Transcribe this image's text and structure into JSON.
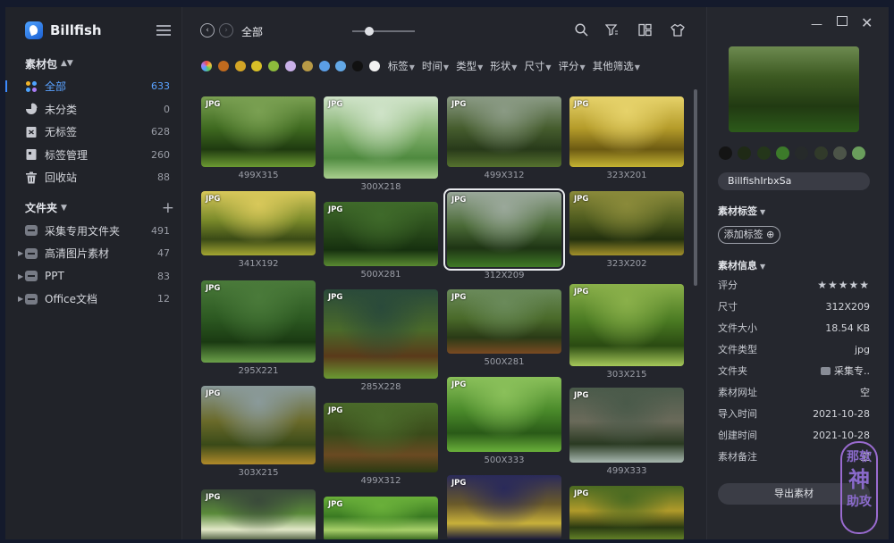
{
  "app": {
    "name": "Billfish"
  },
  "sidebar": {
    "library_title": "素材包",
    "items": [
      {
        "label": "全部",
        "count": "633",
        "icon": "all-grid-icon",
        "active": true
      },
      {
        "label": "未分类",
        "count": "0",
        "icon": "pie-icon"
      },
      {
        "label": "无标签",
        "count": "628",
        "icon": "no-tag-icon"
      },
      {
        "label": "标签管理",
        "count": "260",
        "icon": "tag-manage-icon"
      },
      {
        "label": "回收站",
        "count": "88",
        "icon": "trash-icon"
      }
    ],
    "folders_title": "文件夹",
    "folders": [
      {
        "label": "采集专用文件夹",
        "count": "491"
      },
      {
        "label": "高清图片素材",
        "count": "47"
      },
      {
        "label": "PPT",
        "count": "83"
      },
      {
        "label": "Office文档",
        "count": "12"
      }
    ]
  },
  "toolbar": {
    "breadcrumb": "全部"
  },
  "filters": {
    "colors": [
      "multi",
      "#c06a1e",
      "#d3a526",
      "#d8c028",
      "#8dba3c",
      "#c9b0e8",
      "#b89a46",
      "#5b9ee6",
      "#63a8e6",
      "#111111",
      "#f2f2f2"
    ],
    "labels": [
      "标签",
      "时间",
      "类型",
      "形状",
      "尺寸",
      "评分",
      "其他筛选"
    ]
  },
  "grid": {
    "badge": "JPG",
    "items": [
      {
        "size": "499X315",
        "colors": [
          "#7aa052",
          "#3f6a20",
          "#1f3a10",
          "#6c9a32"
        ]
      },
      {
        "size": "300X218",
        "colors": [
          "#cfe3c8",
          "#7fae6a",
          "#4f8a3f",
          "#a9d08e"
        ]
      },
      {
        "size": "499X312",
        "colors": [
          "#8a9a84",
          "#465d2e",
          "#283a1a",
          "#56722e"
        ]
      },
      {
        "size": "323X201",
        "colors": [
          "#e6d26a",
          "#b59c2a",
          "#6c5a12",
          "#c5b432"
        ]
      },
      {
        "size": "341X192",
        "colors": [
          "#d8c85a",
          "#7a8a2a",
          "#3a4a16",
          "#a4a632"
        ]
      },
      {
        "size": "500X281",
        "colors": [
          "#3f6a2a",
          "#28491a",
          "#16300f",
          "#5a8a32"
        ]
      },
      {
        "size": "312X209",
        "colors": [
          "#9aa89a",
          "#4a6a36",
          "#1e3414",
          "#3f7a26"
        ]
      },
      {
        "size": "323X202",
        "colors": [
          "#8a8a3a",
          "#4d5a1e",
          "#22300e",
          "#a3902a"
        ]
      },
      {
        "size": "295X221",
        "colors": [
          "#4a7a3a",
          "#2d5a22",
          "#1a3a12",
          "#6ca04a"
        ]
      },
      {
        "size": "285X228",
        "colors": [
          "#2a4a3a",
          "#4a6a2a",
          "#5a3a1a",
          "#6a9a32"
        ]
      },
      {
        "size": "500X281",
        "colors": [
          "#6a8a5a",
          "#4a6a2a",
          "#2a3a16",
          "#7a4a22"
        ]
      },
      {
        "size": "303X215",
        "colors": [
          "#8ab04a",
          "#4a7a22",
          "#2a4a12",
          "#a6c85a"
        ]
      },
      {
        "size": "303X215",
        "colors": [
          "#8a9a9a",
          "#6a6a2a",
          "#3a4a18",
          "#b08a2a"
        ]
      },
      {
        "size": "499X312",
        "colors": [
          "#4a6a2a",
          "#3a4a1a",
          "#6a4a22",
          "#2a3a12"
        ]
      },
      {
        "size": "500X333",
        "colors": [
          "#8ac05a",
          "#4a8a2a",
          "#2a5a18",
          "#6ab03a"
        ]
      },
      {
        "size": "499X333",
        "colors": [
          "#4a5a4a",
          "#6a6a5a",
          "#2a3a22",
          "#a8b8b0"
        ]
      },
      {
        "size": "",
        "colors": [
          "#3a4a3a",
          "#5a8a3a",
          "#e2e8c8",
          "#2a3a1e"
        ]
      },
      {
        "size": "",
        "colors": [
          "#6ab03a",
          "#3a7a22",
          "#a8d06a",
          "#2a5a16"
        ]
      },
      {
        "size": "",
        "colors": [
          "#2a2a5a",
          "#6a5a2a",
          "#c8b03a",
          "#1a1a3a"
        ]
      },
      {
        "size": "",
        "colors": [
          "#4a6a22",
          "#b09a2a",
          "#2a3a12",
          "#6a8a2a"
        ]
      }
    ]
  },
  "detail": {
    "palette": [
      "#141414",
      "#1f2a16",
      "#24361a",
      "#3c7a2a",
      "#262a2a",
      "#313a2a",
      "#4c5448",
      "#6a9e5c"
    ],
    "file_name": "BillfishIrbxSa",
    "tags_title": "素材标签",
    "add_tag": "添加标签",
    "info_title": "素材信息",
    "rows": [
      {
        "key": "评分",
        "value": "★★★★★"
      },
      {
        "key": "尺寸",
        "value": "312X209"
      },
      {
        "key": "文件大小",
        "value": "18.54 KB"
      },
      {
        "key": "文件类型",
        "value": "jpg"
      },
      {
        "key": "文件夹",
        "value": "采集专.."
      },
      {
        "key": "素材网址",
        "value": "空"
      },
      {
        "key": "导入时间",
        "value": "2021-10-28"
      },
      {
        "key": "创建时间",
        "value": "2021-10-28"
      },
      {
        "key": "素材备注",
        "value": "空"
      }
    ],
    "export": "导出素材"
  },
  "watermark": {
    "line1": "那软",
    "line2": "神",
    "line3": "助攻"
  }
}
